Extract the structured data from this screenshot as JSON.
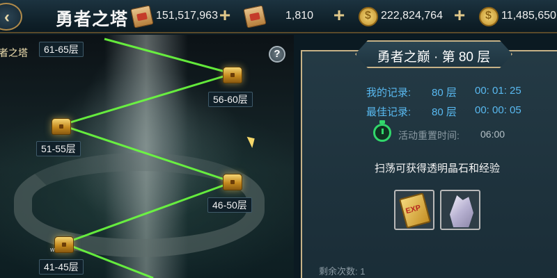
{
  "header": {
    "title": "勇者之塔",
    "resources": [
      {
        "icon": "scroll-icon",
        "value": "151,517,963"
      },
      {
        "icon": "locked-scroll-icon",
        "value": "1,810"
      },
      {
        "icon": "gold-coin-icon",
        "value": "222,824,764"
      },
      {
        "icon": "locked-coin-icon",
        "value": "11,485,650"
      }
    ],
    "add_label": "+"
  },
  "map": {
    "title": "者之塔",
    "help_label": "?",
    "watermark": "w",
    "floors": [
      "61-65层",
      "56-60层",
      "51-55层",
      "46-50层",
      "41-45层"
    ]
  },
  "panel": {
    "title": "勇者之巅 · 第 80 层",
    "my_record": {
      "label": "我的记录:",
      "floor": "80 层",
      "time": "00: 01: 25"
    },
    "best_record": {
      "label": "最佳记录:",
      "floor": "80 层",
      "time": "00: 00: 05"
    },
    "reset_label": "活动重置时间:",
    "reset_time": "06:00",
    "sweep_text": "扫荡可获得透明晶石和经验",
    "rewards": [
      {
        "icon": "exp-book-icon",
        "label": "EXP"
      },
      {
        "icon": "transparent-crystal-icon"
      }
    ],
    "remaining_label": "剩余次数: 1"
  },
  "colors": {
    "path": "#6cff3e",
    "record_text": "#59b9f0",
    "timer": "#31d86b",
    "frame": "#c7b287"
  }
}
